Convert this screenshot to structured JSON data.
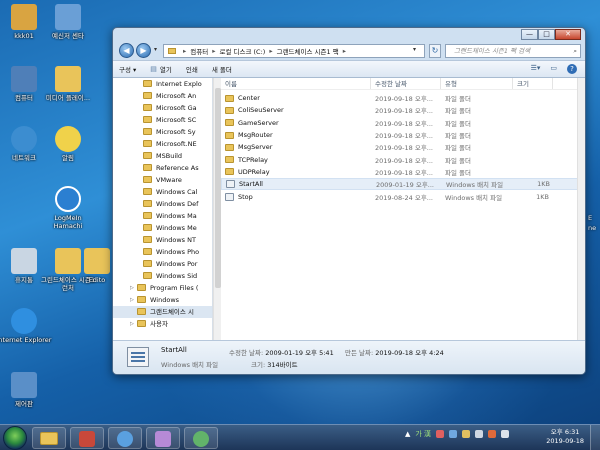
{
  "desktop": {
    "icons": [
      {
        "label": "kkk01",
        "icon": "user-folder-icon",
        "color": "#d9a441"
      },
      {
        "label": "예신저 센타",
        "icon": "messenger-icon",
        "color": "#6a9fd6"
      },
      {
        "label": "컴퓨터",
        "icon": "computer-icon",
        "color": "#4f7fb8"
      },
      {
        "label": "미디어 플레이...",
        "icon": "media-player-icon",
        "color": "#e9c45a"
      },
      {
        "label": "네트워크",
        "icon": "network-icon",
        "color": "#3c8dd0"
      },
      {
        "label": "알림",
        "icon": "alert-cat-icon",
        "color": "#f0d24a"
      },
      {
        "label": "LogMeIn Hamachi",
        "icon": "hamachi-icon",
        "color": "#2b7fd1"
      },
      {
        "label": "휴지통",
        "icon": "recycle-bin-icon",
        "color": "#c9d6e3"
      },
      {
        "label": "그린드체이스 시즌1 런처",
        "icon": "game-folder-icon",
        "color": "#e9c45a"
      },
      {
        "label": "Edito",
        "icon": "editor-folder-icon",
        "color": "#e9c45a"
      },
      {
        "label": "Internet Explorer",
        "icon": "internet-explorer-icon",
        "color": "#2f8fe0"
      },
      {
        "label": "제어판",
        "icon": "control-panel-icon",
        "color": "#5a8fc8"
      }
    ],
    "edge_labels": [
      "E",
      "ne"
    ]
  },
  "window": {
    "controls": {
      "minimize": "—",
      "maximize": "□",
      "close": "✕"
    },
    "address": {
      "segments": [
        "컴퓨터",
        "로컬 디스크 (C:)",
        "그랜드체이스 시즌1 팩"
      ],
      "search_placeholder": "그랜드체이스 시즌1 팩 검색"
    },
    "toolbar": {
      "organize": "구성 ▾",
      "open": "열기",
      "print": "인쇄",
      "new_folder": "새 폴더"
    },
    "nav_pane": {
      "items": [
        {
          "label": "Internet Explo",
          "selected": false
        },
        {
          "label": "Microsoft An",
          "selected": false
        },
        {
          "label": "Microsoft Ga",
          "selected": false
        },
        {
          "label": "Microsoft SC",
          "selected": false
        },
        {
          "label": "Microsoft Sy",
          "selected": false
        },
        {
          "label": "Microsoft.NE",
          "selected": false
        },
        {
          "label": "MSBuild",
          "selected": false
        },
        {
          "label": "Reference As",
          "selected": false
        },
        {
          "label": "VMware",
          "selected": false
        },
        {
          "label": "Windows Cal",
          "selected": false
        },
        {
          "label": "Windows Def",
          "selected": false
        },
        {
          "label": "Windows Ma",
          "selected": false
        },
        {
          "label": "Windows Me",
          "selected": false
        },
        {
          "label": "Windows NT",
          "selected": false
        },
        {
          "label": "Windows Pho",
          "selected": false
        },
        {
          "label": "Windows Por",
          "selected": false
        },
        {
          "label": "Windows Sid",
          "selected": false
        },
        {
          "label": "Program Files (",
          "selected": false
        },
        {
          "label": "Windows",
          "selected": false
        },
        {
          "label": "그랜드체이스 시",
          "selected": true
        },
        {
          "label": "사용자",
          "selected": false
        }
      ]
    },
    "columns": {
      "name": "이름",
      "modified": "수정한 날짜",
      "type": "유형",
      "size": "크기"
    },
    "files": [
      {
        "name": "Center",
        "modified": "2019-09-18 오후...",
        "type": "파일 폴더",
        "size": "",
        "kind": "folder",
        "selected": false
      },
      {
        "name": "ColiSeuServer",
        "modified": "2019-09-18 오후...",
        "type": "파일 폴더",
        "size": "",
        "kind": "folder",
        "selected": false
      },
      {
        "name": "GameServer",
        "modified": "2019-09-18 오후...",
        "type": "파일 폴더",
        "size": "",
        "kind": "folder",
        "selected": false
      },
      {
        "name": "MsgRouter",
        "modified": "2019-09-18 오후...",
        "type": "파일 폴더",
        "size": "",
        "kind": "folder",
        "selected": false
      },
      {
        "name": "MsgServer",
        "modified": "2019-09-18 오후...",
        "type": "파일 폴더",
        "size": "",
        "kind": "folder",
        "selected": false
      },
      {
        "name": "TCPRelay",
        "modified": "2019-09-18 오후...",
        "type": "파일 폴더",
        "size": "",
        "kind": "folder",
        "selected": false
      },
      {
        "name": "UDPRelay",
        "modified": "2019-09-18 오후...",
        "type": "파일 폴더",
        "size": "",
        "kind": "folder",
        "selected": false
      },
      {
        "name": "StartAll",
        "modified": "2009-01-19 오후...",
        "type": "Windows 배치 파일",
        "size": "1KB",
        "kind": "batch",
        "selected": true
      },
      {
        "name": "Stop",
        "modified": "2019-08-24 오후...",
        "type": "Windows 배치 파일",
        "size": "1KB",
        "kind": "batch",
        "selected": false
      }
    ],
    "details": {
      "name": "StartAll",
      "type": "Windows 배치 파일",
      "modified_label": "수정한 날짜:",
      "modified_value": "2009-01-19 오후 5:41",
      "created_label": "만든 날짜:",
      "created_value": "2019-09-18 오후 4:24",
      "size_label": "크기:",
      "size_value": "314바이트"
    }
  },
  "taskbar": {
    "apps": [
      {
        "icon": "explorer-app-icon",
        "color": "#e9c45a"
      },
      {
        "icon": "game-app-icon",
        "color": "#c8483a"
      },
      {
        "icon": "messenger-app-icon",
        "color": "#5aa0e0"
      },
      {
        "icon": "character-app-icon",
        "color": "#b68ad6"
      },
      {
        "icon": "users-app-icon",
        "color": "#62b36a"
      }
    ],
    "tray": {
      "ime": "가 漢"
    },
    "clock": {
      "time": "오후 6:31",
      "date": "2019-09-18"
    }
  }
}
